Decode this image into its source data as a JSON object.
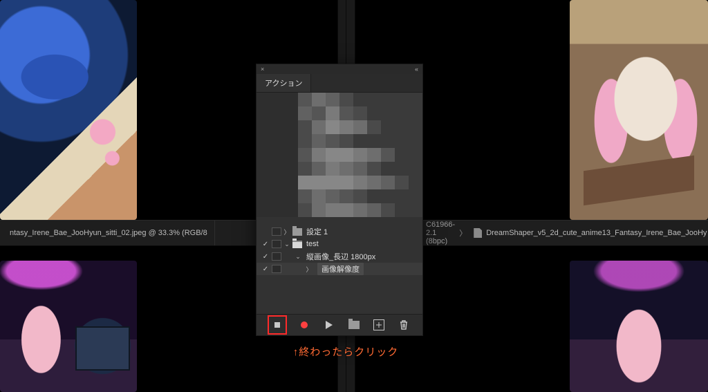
{
  "panel": {
    "tab_label": "アクション",
    "tree": {
      "settings_set": {
        "label": "設定 1"
      },
      "user_set": {
        "label": "test"
      },
      "action": {
        "label": "縦画像_長辺 1800px"
      },
      "step": {
        "label": "画像解像度"
      }
    }
  },
  "tabs": {
    "left_tail": "ntasy_Irene_Bae_JooHyun_sitti_02.jpeg @ 33.3% (RGB/8",
    "right_profile_tail": "C61966-2.1 (8bpc)",
    "right_doc": "DreamShaper_v5_2d_cute_anime13_Fantasy_Irene_Bae_JooHy"
  },
  "annotation": "↑終わったらクリック",
  "colors": {
    "highlight": "#ff2a2a",
    "annotation": "#ff6a33",
    "record": "#ff4040",
    "panel_bg": "#323232"
  }
}
